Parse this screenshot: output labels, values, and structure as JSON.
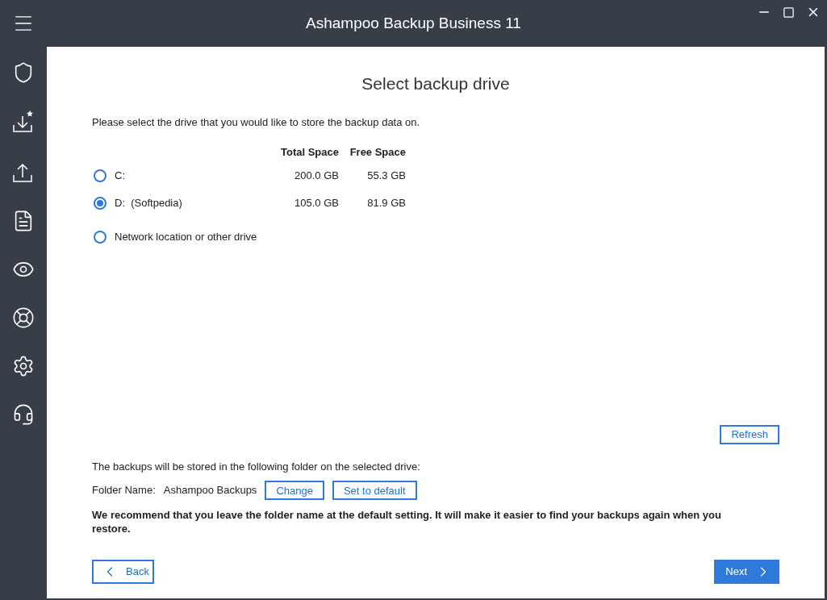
{
  "window": {
    "title": "Ashampoo Backup Business 11"
  },
  "page": {
    "heading": "Select backup drive",
    "instruction": "Please select the drive that you would like to store the backup data on.",
    "columns": [
      "Total Space",
      "Free Space"
    ],
    "drives": [
      {
        "label": "C:",
        "total": "200.0 GB",
        "free": "55.3 GB",
        "selected": false
      },
      {
        "label": "D:  (Softpedia)",
        "total": "105.0 GB",
        "free": "81.9 GB",
        "selected": true
      },
      {
        "label": "Network location or other drive",
        "selected": false
      }
    ],
    "refresh_button": "Refresh",
    "folder_intro": "The backups will be stored in the following folder on the selected drive:",
    "folder_label": "Folder Name:",
    "folder_value": "Ashampoo Backups",
    "folder_buttons": [
      "Change",
      "Set to default"
    ],
    "recommendation": "We recommend that you leave the folder name at the default setting. It will make it easier to find your backups again when you restore.",
    "back_button": "Back",
    "next_button": "Next"
  }
}
